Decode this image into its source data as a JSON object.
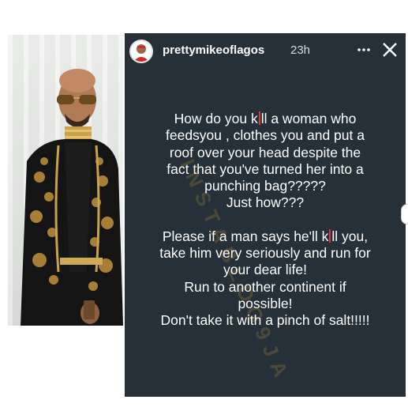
{
  "story": {
    "username": "prettymikeoflagos",
    "time_ago": "23h",
    "watermark": "INSTABLOG9JA",
    "paragraph1": [
      "How do you k*ll a woman who",
      "feedsyou , clothes you and put a",
      "roof over your head despite the",
      "fact that you've turned her into a",
      "punching bag?????",
      "Just how???"
    ],
    "paragraph2": [
      "Please if a man says he'll k*ll you,",
      "take him very seriously and run for",
      "your dear life!",
      "Run to another continent if",
      "possible!",
      "Don't take it with a pinch of salt!!!!!"
    ]
  },
  "icons": {
    "more": "more-horizontal-icon",
    "close": "close-icon",
    "avatar": "profile-avatar"
  },
  "colors": {
    "story_background": "#263038",
    "text": "#ffffff",
    "censor_mark": "#e4343a"
  }
}
